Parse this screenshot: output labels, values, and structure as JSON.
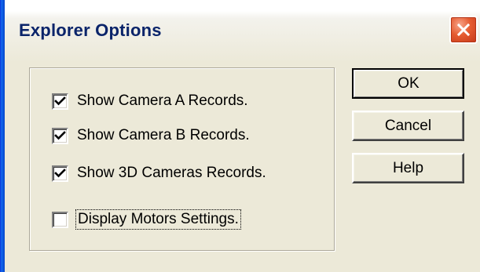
{
  "window": {
    "title": "Explorer Options"
  },
  "options": [
    {
      "label": "Show Camera A Records.",
      "checked": true
    },
    {
      "label": "Show Camera B Records.",
      "checked": true
    },
    {
      "label": "Show 3D Cameras Records.",
      "checked": true
    },
    {
      "label": "Display Motors Settings.",
      "checked": false
    }
  ],
  "buttons": {
    "ok": "OK",
    "cancel": "Cancel",
    "help": "Help"
  },
  "colors": {
    "title_text": "#0a246a",
    "face": "#ece9d8",
    "close_button": "#e55b30",
    "frame_blue": "#0855dd"
  },
  "icons": {
    "close": "close-icon",
    "check": "checkmark-icon"
  }
}
